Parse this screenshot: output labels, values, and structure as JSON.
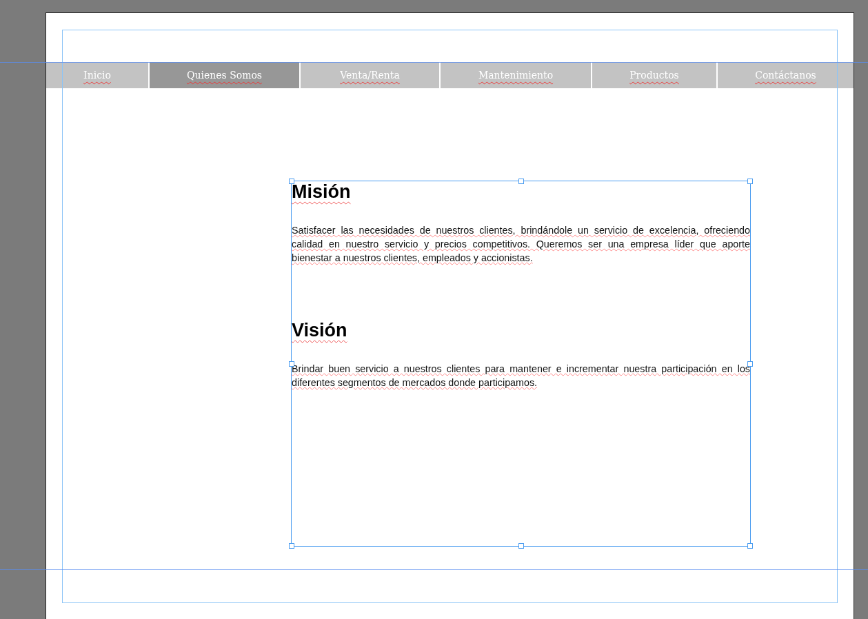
{
  "nav": {
    "tabs": [
      {
        "label": "Inicio",
        "selected": false
      },
      {
        "label": "Quienes Somos",
        "selected": true
      },
      {
        "label": "Venta/Renta",
        "selected": false
      },
      {
        "label": "Mantenimiento",
        "selected": false
      },
      {
        "label": "Productos",
        "selected": false
      },
      {
        "label": "Contáctanos",
        "selected": false
      }
    ]
  },
  "sections": [
    {
      "heading": "Misión",
      "body": "Satisfacer las necesidades de nuestros clientes, brindándole un servicio de excelencia, ofreciendo calidad en nuestro servicio y precios competitivos.  Queremos ser una empresa líder que aporte bienestar a nuestros clientes, empleados y accionistas."
    },
    {
      "heading": "Visión",
      "body": "Brindar buen servicio a nuestros clientes para mantener e incrementar nuestra participación en los diferentes segmentos de mercados donde participamos."
    }
  ]
}
